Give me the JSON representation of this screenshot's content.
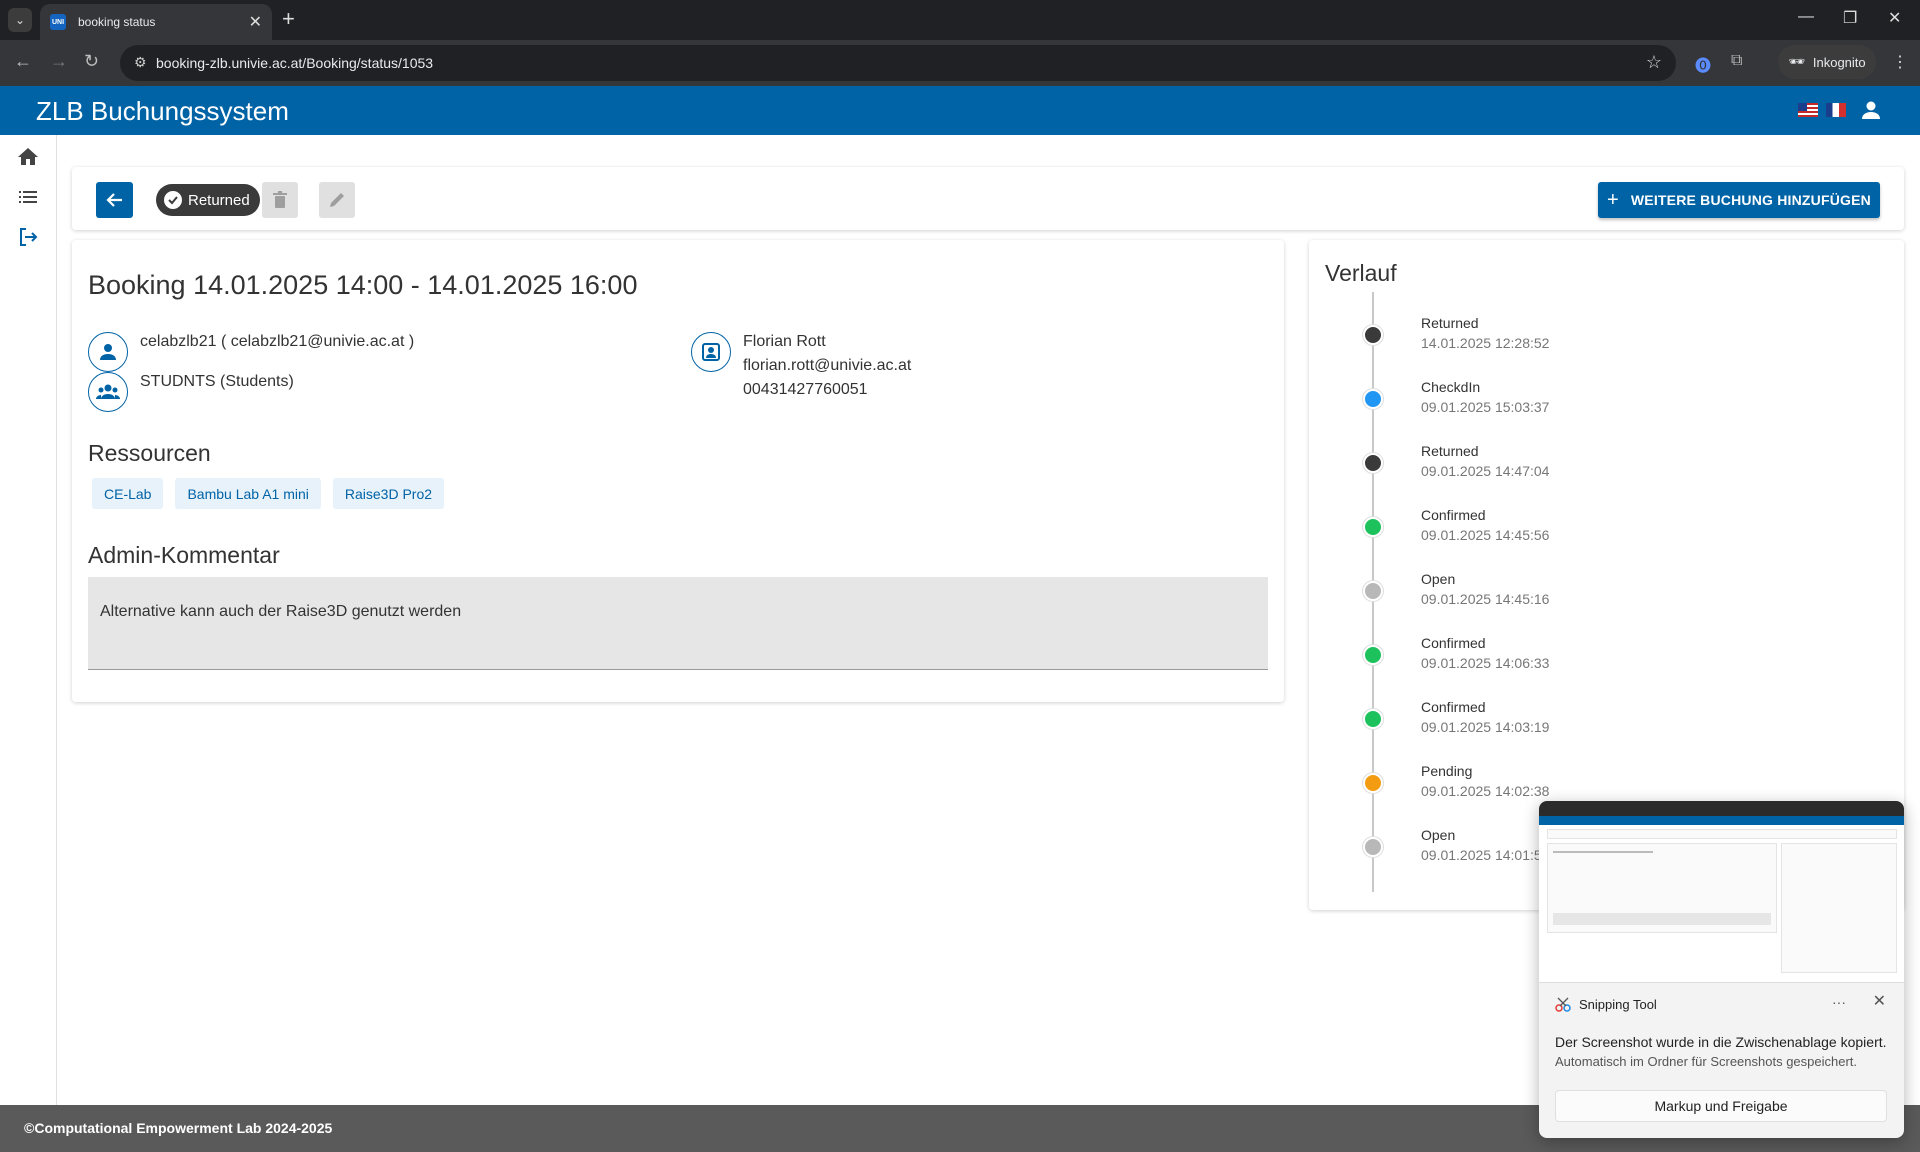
{
  "browser": {
    "tab_title": "booking status",
    "favicon_text": "UNI",
    "url": "booking-zlb.univie.ac.at/Booking/status/1053",
    "incognito_label": "Inkognito"
  },
  "header": {
    "title": "ZLB Buchungssystem"
  },
  "toolbar": {
    "status_label": "Returned",
    "add_label": "WEITERE BUCHUNG HINZUFÜGEN"
  },
  "booking": {
    "title": "Booking 14.01.2025 14:00 - 14.01.2025 16:00",
    "user": "celabzlb21 ( celabzlb21@univie.ac.at )",
    "group": "STUDNTS (Students)",
    "contact_name": "Florian Rott",
    "contact_email": "florian.rott@univie.ac.at",
    "contact_phone": "00431427760051",
    "resources_title": "Ressourcen",
    "resources": [
      "CE-Lab",
      "Bambu Lab A1 mini",
      "Raise3D Pro2"
    ],
    "comment_title": "Admin-Kommentar",
    "comment": "Alternative kann auch der Raise3D genutzt werden"
  },
  "history": {
    "title": "Verlauf",
    "items": [
      {
        "status": "Returned",
        "time": "14.01.2025 12:28:52",
        "color": "#3a3a3a"
      },
      {
        "status": "CheckdIn",
        "time": "09.01.2025 15:03:37",
        "color": "#2196f3"
      },
      {
        "status": "Returned",
        "time": "09.01.2025 14:47:04",
        "color": "#3a3a3a"
      },
      {
        "status": "Confirmed",
        "time": "09.01.2025 14:45:56",
        "color": "#1ec25c"
      },
      {
        "status": "Open",
        "time": "09.01.2025 14:45:16",
        "color": "#b8b8b8"
      },
      {
        "status": "Confirmed",
        "time": "09.01.2025 14:06:33",
        "color": "#1ec25c"
      },
      {
        "status": "Confirmed",
        "time": "09.01.2025 14:03:19",
        "color": "#1ec25c"
      },
      {
        "status": "Pending",
        "time": "09.01.2025 14:02:38",
        "color": "#f39c12"
      },
      {
        "status": "Open",
        "time": "09.01.2025 14:01:5",
        "color": "#b8b8b8"
      }
    ]
  },
  "footer": {
    "text": "Computational Empowerment Lab 2024-2025"
  },
  "toast": {
    "app_name": "Snipping Tool",
    "message": "Der Screenshot wurde in die Zwischenablage kopiert.",
    "sub_message": "Automatisch im Ordner für Screenshots gespeichert.",
    "button": "Markup und Freigabe",
    "more": "···",
    "close": "✕"
  },
  "colors": {
    "primary": "#0063a6",
    "footer": "#5a5a5a"
  }
}
